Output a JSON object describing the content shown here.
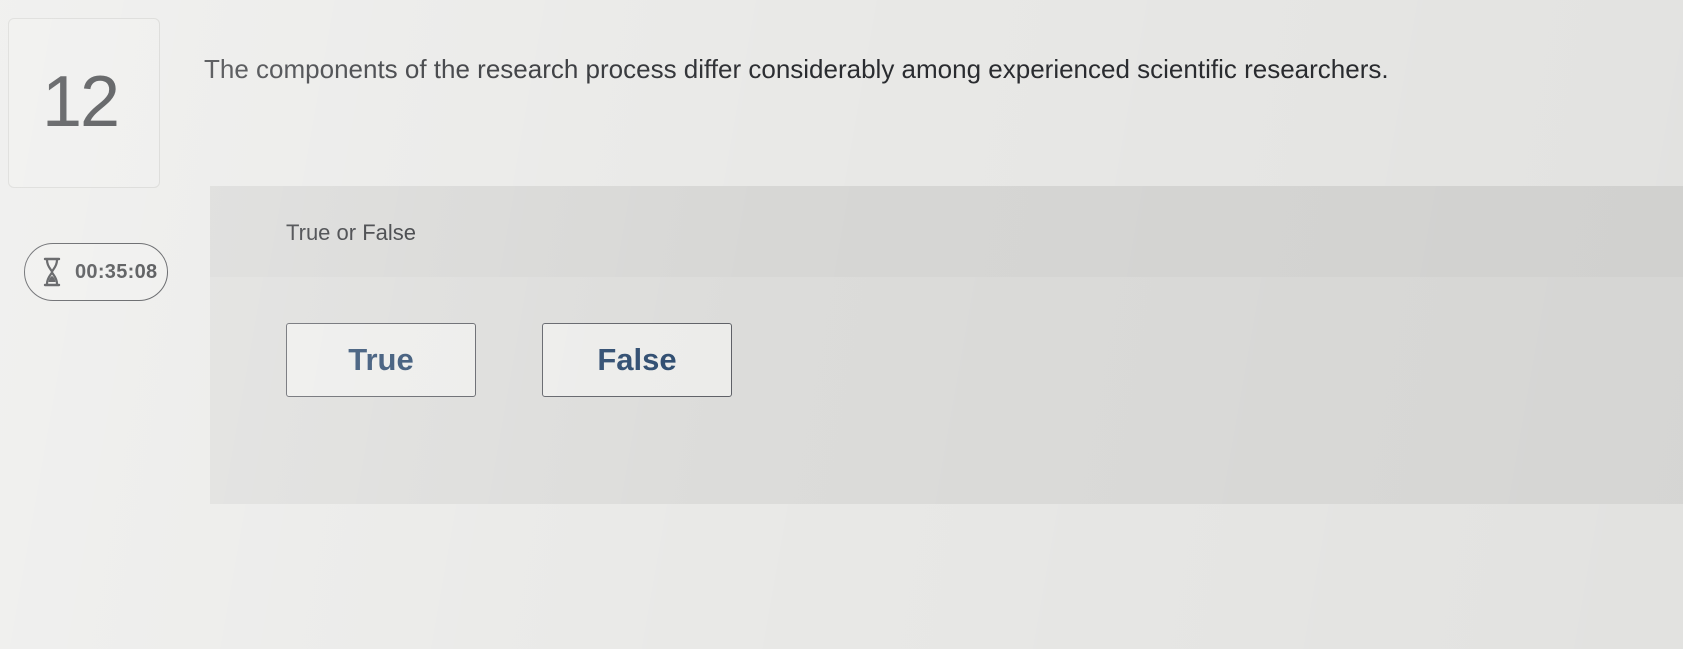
{
  "question": {
    "number": "12",
    "text": "The components of the research process differ considerably among experienced scientific researchers."
  },
  "timer": {
    "icon": "hourglass-icon",
    "value": "00:35:08"
  },
  "answer": {
    "type_label": "True or False",
    "options": [
      {
        "label": "True"
      },
      {
        "label": "False"
      }
    ]
  },
  "colors": {
    "button_text": "#2c4a6e",
    "panel_bg": "#dcdcda",
    "page_bg": "#e9e9e7"
  }
}
